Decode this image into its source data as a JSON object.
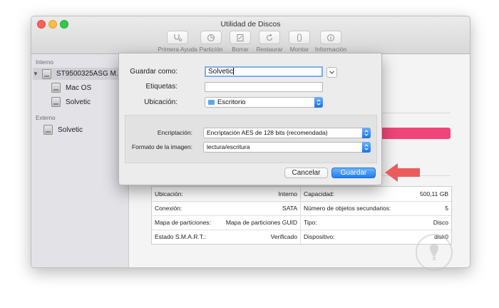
{
  "window": {
    "title": "Utilidad de Discos"
  },
  "toolbar": [
    {
      "label": "Primera Ayuda",
      "icon": "stethoscope-icon"
    },
    {
      "label": "Partición",
      "icon": "partition-icon"
    },
    {
      "label": "Borrar",
      "icon": "erase-icon"
    },
    {
      "label": "Restaurar",
      "icon": "restore-icon"
    },
    {
      "label": "Montar",
      "icon": "mount-icon"
    },
    {
      "label": "Información",
      "icon": "info-icon"
    }
  ],
  "sidebar": {
    "internal_header": "Interno",
    "disk_name": "ST9500325ASG M...",
    "volumes": [
      "Mac OS",
      "Solvetic"
    ],
    "external_header": "Externo",
    "external_items": [
      "Solvetic"
    ]
  },
  "colors": {
    "bar_blue": "#2fb4ef",
    "bar_pink": "#f0457a",
    "accent": "#1f7ef2",
    "arrow": "#ec5b5b"
  },
  "dialog": {
    "save_as_label": "Guardar como:",
    "save_as_value": "Solvetic",
    "tags_label": "Etiquetas:",
    "tags_value": "",
    "location_label": "Ubicación:",
    "location_value": "Escritorio",
    "encryption_label": "Encriptación:",
    "encryption_value": "Encriptación AES de 128 bits (recomendada)",
    "format_label": "Formato de la imagen:",
    "format_value": "lectura/escritura",
    "cancel_label": "Cancelar",
    "save_label": "Guardar"
  },
  "info": {
    "left": [
      {
        "key": "Ubicación:",
        "value": "Interno"
      },
      {
        "key": "Conexión:",
        "value": "SATA"
      },
      {
        "key": "Mapa de particiones:",
        "value": "Mapa de particiones GUID"
      },
      {
        "key": "Estado S.M.A.R.T.:",
        "value": "Verificado"
      }
    ],
    "right": [
      {
        "key": "Capacidad:",
        "value": "500,11 GB"
      },
      {
        "key": "Número de objetos secundarios:",
        "value": "5"
      },
      {
        "key": "Tipo:",
        "value": "Disco"
      },
      {
        "key": "Dispositivo:",
        "value": "disk0"
      }
    ]
  }
}
